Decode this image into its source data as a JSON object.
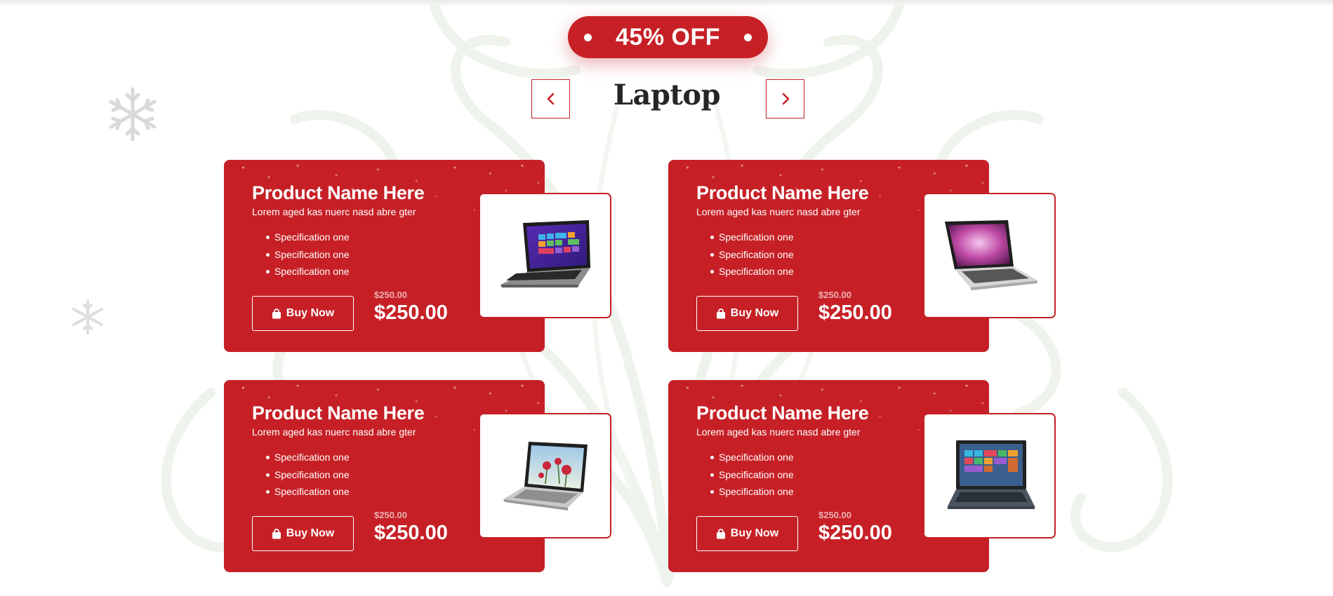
{
  "colors": {
    "accent": "#c62026",
    "title": "#262626",
    "ornament": "#eef3ec"
  },
  "promo": {
    "label": "45% OFF"
  },
  "section": {
    "title": "Laptop",
    "prev_icon": "chevron-left-icon",
    "next_icon": "chevron-right-icon"
  },
  "products": [
    {
      "name": "Product Name Here",
      "description": "Lorem aged kas nuerc nasd abre gter",
      "specs": [
        "Specification one",
        "Specification one",
        "Specification one"
      ],
      "button_label": "Buy Now",
      "button_icon": "shopping-bag-icon",
      "old_price": "$250.00",
      "price": "$250.00",
      "image": "windows-laptop-dark"
    },
    {
      "name": "Product Name Here",
      "description": "Lorem aged kas nuerc nasd abre gter",
      "specs": [
        "Specification one",
        "Specification one",
        "Specification one"
      ],
      "button_label": "Buy Now",
      "button_icon": "shopping-bag-icon",
      "old_price": "$250.00",
      "price": "$250.00",
      "image": "silver-laptop-pink-wallpaper"
    },
    {
      "name": "Product Name Here",
      "description": "Lorem aged kas nuerc nasd abre gter",
      "specs": [
        "Specification one",
        "Specification one",
        "Specification one"
      ],
      "button_label": "Buy Now",
      "button_icon": "shopping-bag-icon",
      "old_price": "$250.00",
      "price": "$250.00",
      "image": "silver-laptop-flower-wallpaper"
    },
    {
      "name": "Product Name Here",
      "description": "Lorem aged kas nuerc nasd abre gter",
      "specs": [
        "Specification one",
        "Specification one",
        "Specification one"
      ],
      "button_label": "Buy Now",
      "button_icon": "shopping-bag-icon",
      "old_price": "$250.00",
      "price": "$250.00",
      "image": "gray-laptop-windows-tiles"
    }
  ]
}
